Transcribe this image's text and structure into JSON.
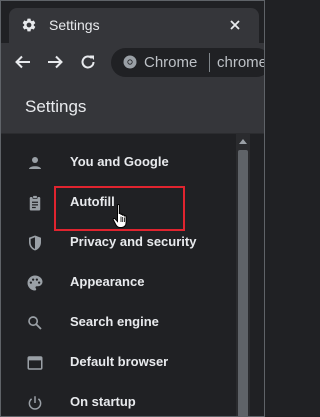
{
  "tab": {
    "title": "Settings",
    "icon": "gear-icon",
    "close_icon": "close-icon"
  },
  "toolbar": {
    "back_icon": "arrow-left-icon",
    "forward_icon": "arrow-right-icon",
    "reload_icon": "reload-icon",
    "site_icon": "chrome-icon",
    "site_label": "Chrome",
    "url": "chrome://settings"
  },
  "header": {
    "title": "Settings"
  },
  "sidebar": {
    "items": [
      {
        "label": "You and Google",
        "icon": "person-icon"
      },
      {
        "label": "Autofill",
        "icon": "clipboard-icon"
      },
      {
        "label": "Privacy and security",
        "icon": "shield-icon"
      },
      {
        "label": "Appearance",
        "icon": "palette-icon"
      },
      {
        "label": "Search engine",
        "icon": "search-icon"
      },
      {
        "label": "Default browser",
        "icon": "browser-window-icon"
      },
      {
        "label": "On startup",
        "icon": "power-icon"
      }
    ]
  },
  "colors": {
    "background": "#202124",
    "surface": "#35363a",
    "text": "#e8eaed",
    "muted_text": "#bdc1c6",
    "icon": "#9aa0a6",
    "highlight": "#e0242f"
  }
}
